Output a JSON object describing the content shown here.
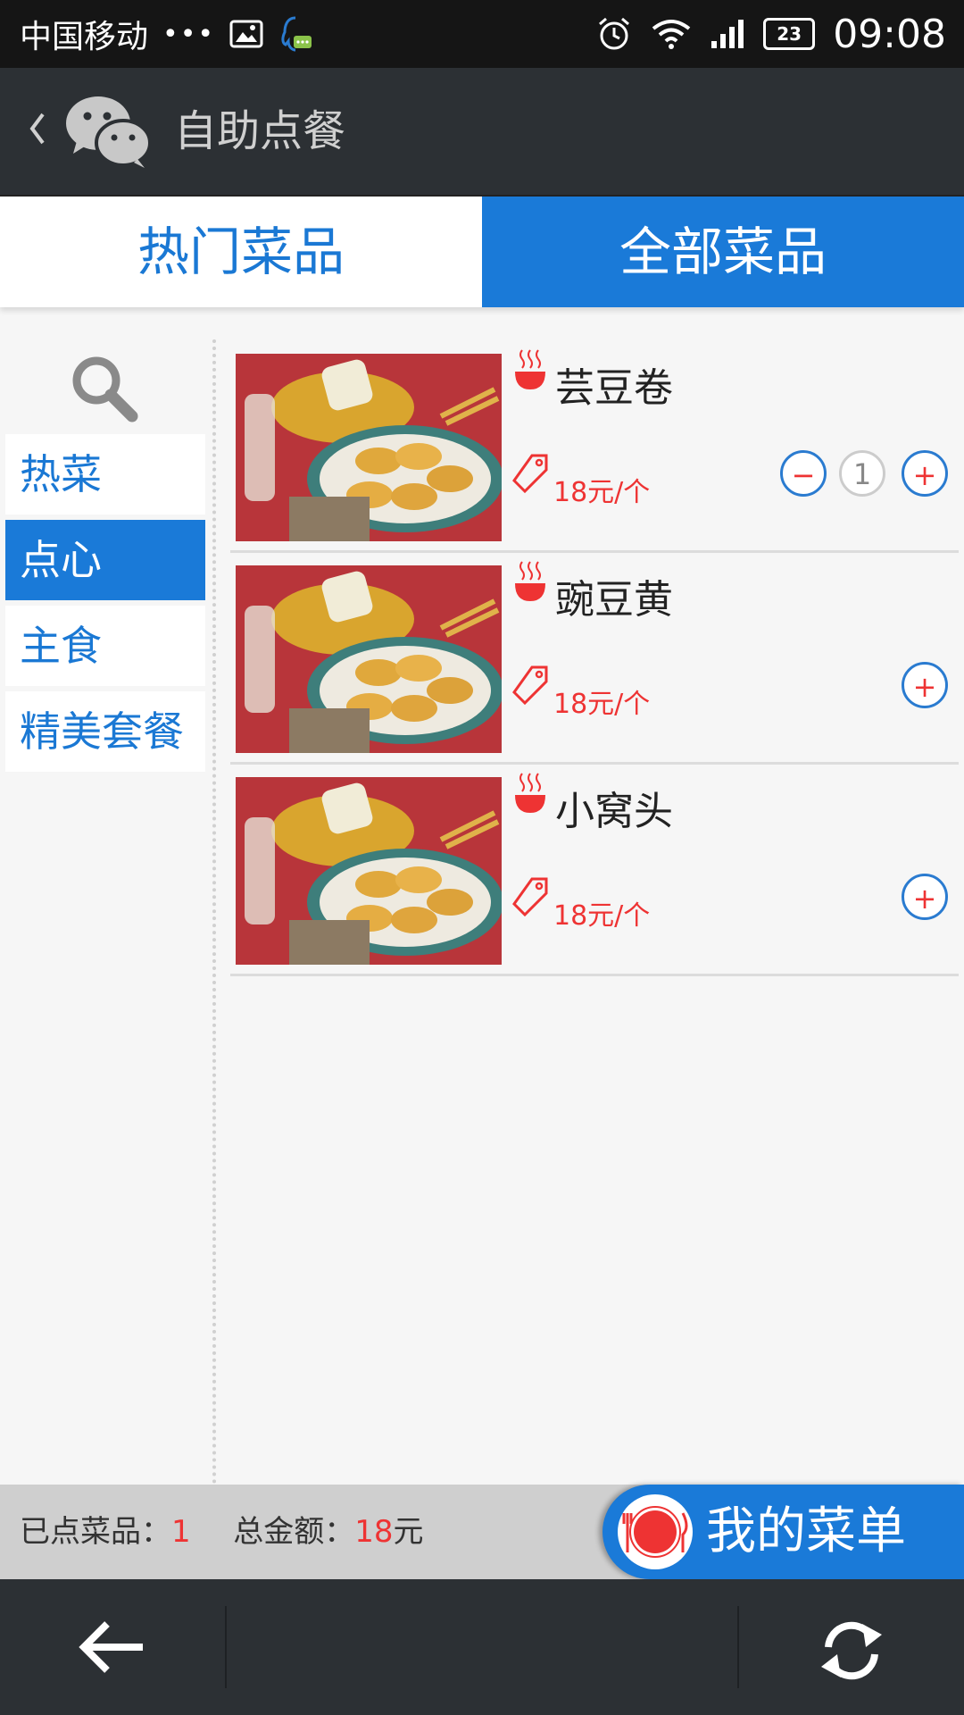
{
  "status_bar": {
    "carrier": "中国移动",
    "dots": "•••",
    "battery": "23",
    "time": "09:08"
  },
  "header": {
    "title": "自助点餐"
  },
  "tabs": [
    {
      "label": "热门菜品"
    },
    {
      "label": "全部菜品"
    }
  ],
  "sidebar": {
    "categories": [
      {
        "label": "热菜"
      },
      {
        "label": "点心"
      },
      {
        "label": "主食"
      },
      {
        "label": "精美套餐"
      }
    ]
  },
  "dishes": [
    {
      "name": "芸豆卷",
      "price": "18元/个",
      "quantity": "1"
    },
    {
      "name": "豌豆黄",
      "price": "18元/个"
    },
    {
      "name": "小窝头",
      "price": "18元/个"
    }
  ],
  "summary": {
    "ordered_label": "已点菜品：",
    "ordered_count": "1",
    "total_label": "总金额：",
    "total_value": "18",
    "total_unit": "元"
  },
  "menu_button": {
    "label": "我的菜单"
  },
  "buttons": {
    "minus": "−",
    "plus": "+"
  },
  "colors": {
    "accent": "#1a7ad8",
    "price": "#e33333",
    "header_bg": "#2c3034"
  }
}
